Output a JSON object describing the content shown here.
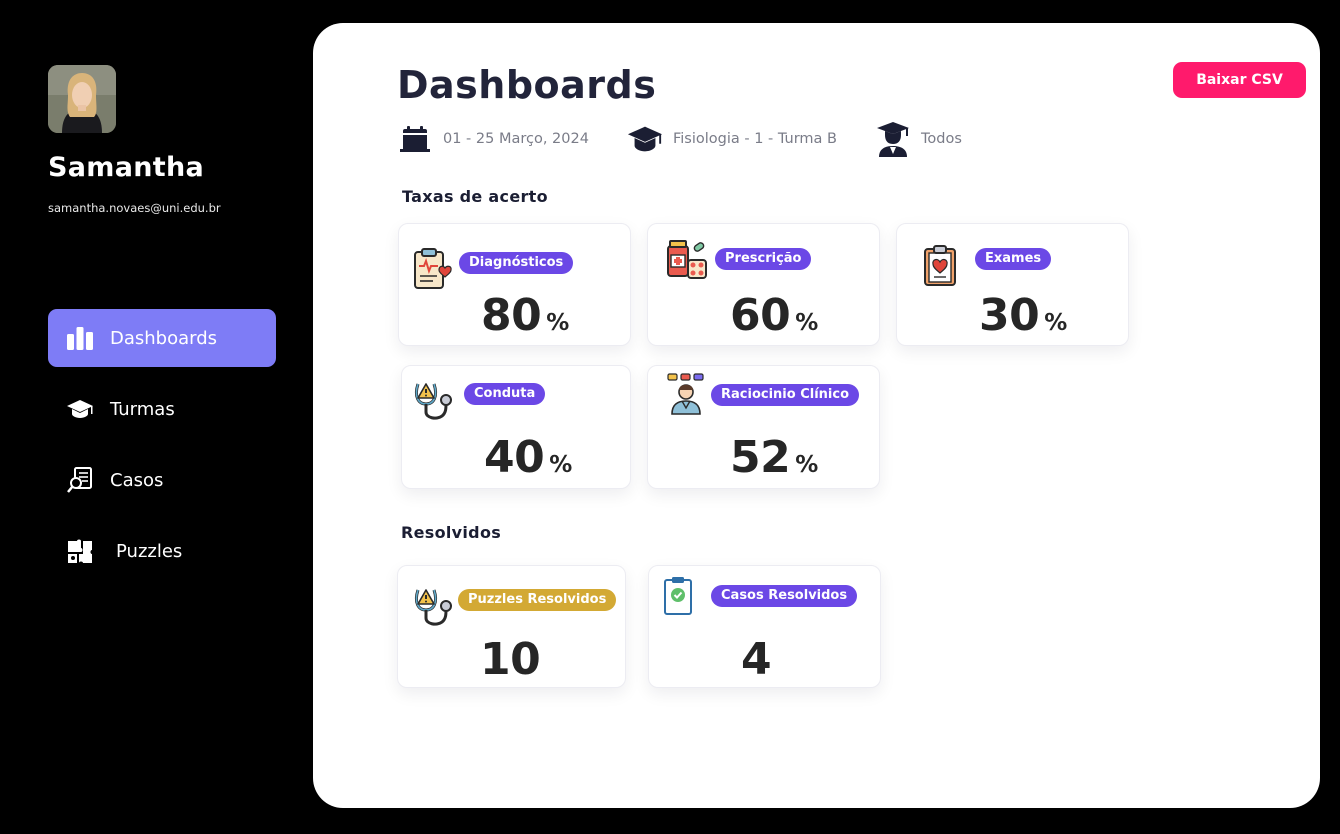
{
  "user": {
    "name": "Samantha",
    "email": "samantha.novaes@uni.edu.br"
  },
  "nav": {
    "items": [
      {
        "label": "Dashboards",
        "icon": "bar-chart-icon",
        "active": true
      },
      {
        "label": "Turmas",
        "icon": "graduation-cap-icon",
        "active": false
      },
      {
        "label": "Casos",
        "icon": "case-search-icon",
        "active": false
      },
      {
        "label": "Puzzles",
        "icon": "puzzle-icon",
        "active": false
      }
    ]
  },
  "header": {
    "title": "Dashboards",
    "csv_button": "Baixar CSV"
  },
  "filters": {
    "date": "01 - 25 Março, 2024",
    "class": "Fisiologia - 1 - Turma B",
    "students": "Todos"
  },
  "sections": {
    "accuracy_title": "Taxas de acerto",
    "solved_title": "Resolvidos"
  },
  "accuracy": [
    {
      "label": "Diagnósticos",
      "value": "80",
      "unit": "%",
      "icon": "clipboard-heart-icon"
    },
    {
      "label": "Prescrição",
      "value": "60",
      "unit": "%",
      "icon": "medicine-icon"
    },
    {
      "label": "Exames",
      "value": "30",
      "unit": "%",
      "icon": "medical-chart-icon"
    },
    {
      "label": "Conduta",
      "value": "40",
      "unit": "%",
      "icon": "stethoscope-warning-icon"
    },
    {
      "label": "Raciocinio Clínico",
      "value": "52",
      "unit": "%",
      "icon": "doctor-thinking-icon"
    }
  ],
  "solved": [
    {
      "label": "Puzzles Resolvidos",
      "value": "10",
      "icon": "stethoscope-warning-icon"
    },
    {
      "label": "Casos Resolvidos",
      "value": "4",
      "icon": "clipboard-check-icon"
    }
  ],
  "colors": {
    "background": "#000000",
    "active_nav": "#7e7cf6",
    "csv_button": "#ff1a6c",
    "badge_purple": "#6b48e6",
    "badge_gold": "#d3a934"
  }
}
